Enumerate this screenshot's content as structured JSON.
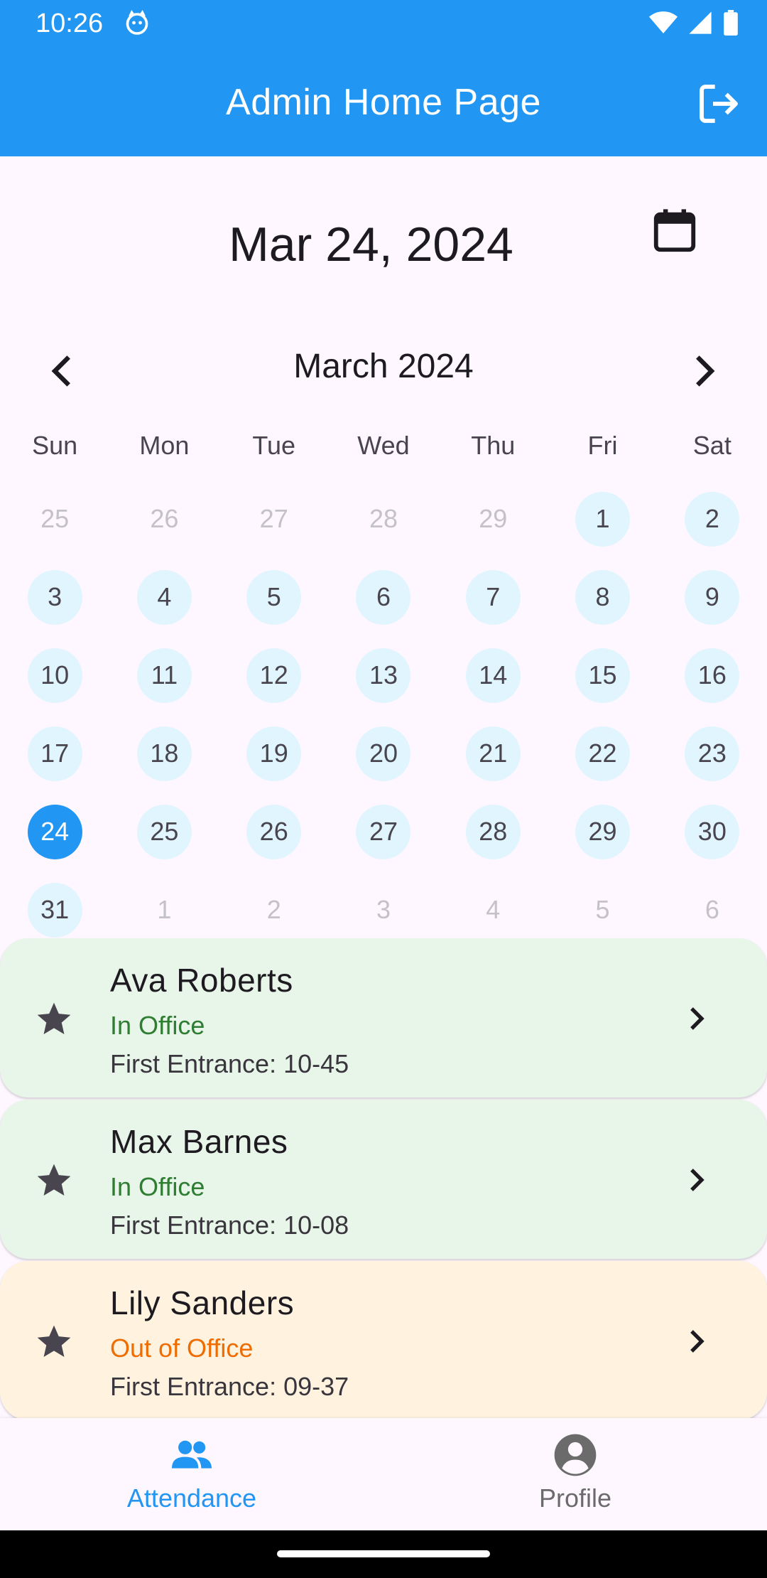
{
  "status_bar": {
    "time": "10:26"
  },
  "app_bar": {
    "title": "Admin Home Page"
  },
  "date_heading": "Mar 24, 2024",
  "calendar": {
    "month_label": "March 2024",
    "weekdays": [
      "Sun",
      "Mon",
      "Tue",
      "Wed",
      "Thu",
      "Fri",
      "Sat"
    ],
    "weeks": [
      [
        {
          "d": "25",
          "s": "outside"
        },
        {
          "d": "26",
          "s": "outside"
        },
        {
          "d": "27",
          "s": "outside"
        },
        {
          "d": "28",
          "s": "outside"
        },
        {
          "d": "29",
          "s": "outside"
        },
        {
          "d": "1",
          "s": "avail"
        },
        {
          "d": "2",
          "s": "avail"
        }
      ],
      [
        {
          "d": "3",
          "s": "avail"
        },
        {
          "d": "4",
          "s": "avail"
        },
        {
          "d": "5",
          "s": "avail"
        },
        {
          "d": "6",
          "s": "avail"
        },
        {
          "d": "7",
          "s": "avail"
        },
        {
          "d": "8",
          "s": "avail"
        },
        {
          "d": "9",
          "s": "avail"
        }
      ],
      [
        {
          "d": "10",
          "s": "avail"
        },
        {
          "d": "11",
          "s": "avail"
        },
        {
          "d": "12",
          "s": "avail"
        },
        {
          "d": "13",
          "s": "avail"
        },
        {
          "d": "14",
          "s": "avail"
        },
        {
          "d": "15",
          "s": "avail"
        },
        {
          "d": "16",
          "s": "avail"
        }
      ],
      [
        {
          "d": "17",
          "s": "avail"
        },
        {
          "d": "18",
          "s": "avail"
        },
        {
          "d": "19",
          "s": "avail"
        },
        {
          "d": "20",
          "s": "avail"
        },
        {
          "d": "21",
          "s": "avail"
        },
        {
          "d": "22",
          "s": "avail"
        },
        {
          "d": "23",
          "s": "avail"
        }
      ],
      [
        {
          "d": "24",
          "s": "selected"
        },
        {
          "d": "25",
          "s": "avail"
        },
        {
          "d": "26",
          "s": "avail"
        },
        {
          "d": "27",
          "s": "avail"
        },
        {
          "d": "28",
          "s": "avail"
        },
        {
          "d": "29",
          "s": "avail"
        },
        {
          "d": "30",
          "s": "avail"
        }
      ],
      [
        {
          "d": "31",
          "s": "avail"
        },
        {
          "d": "1",
          "s": "outside"
        },
        {
          "d": "2",
          "s": "outside"
        },
        {
          "d": "3",
          "s": "outside"
        },
        {
          "d": "4",
          "s": "outside"
        },
        {
          "d": "5",
          "s": "outside"
        },
        {
          "d": "6",
          "s": "outside"
        }
      ]
    ]
  },
  "employees": [
    {
      "name": "Ava Roberts",
      "status": "In Office",
      "status_type": "in",
      "entrance": "First Entrance: 10-45"
    },
    {
      "name": "Max Barnes",
      "status": "In Office",
      "status_type": "in",
      "entrance": "First Entrance: 10-08"
    },
    {
      "name": "Lily Sanders",
      "status": "Out of Office",
      "status_type": "out",
      "entrance": "First Entrance: 09-37"
    }
  ],
  "bottom_nav": {
    "attendance_label": "Attendance",
    "profile_label": "Profile"
  },
  "colors": {
    "primary": "#2196F3",
    "in_office": "#2E7D32",
    "out_office": "#EF6C00"
  }
}
